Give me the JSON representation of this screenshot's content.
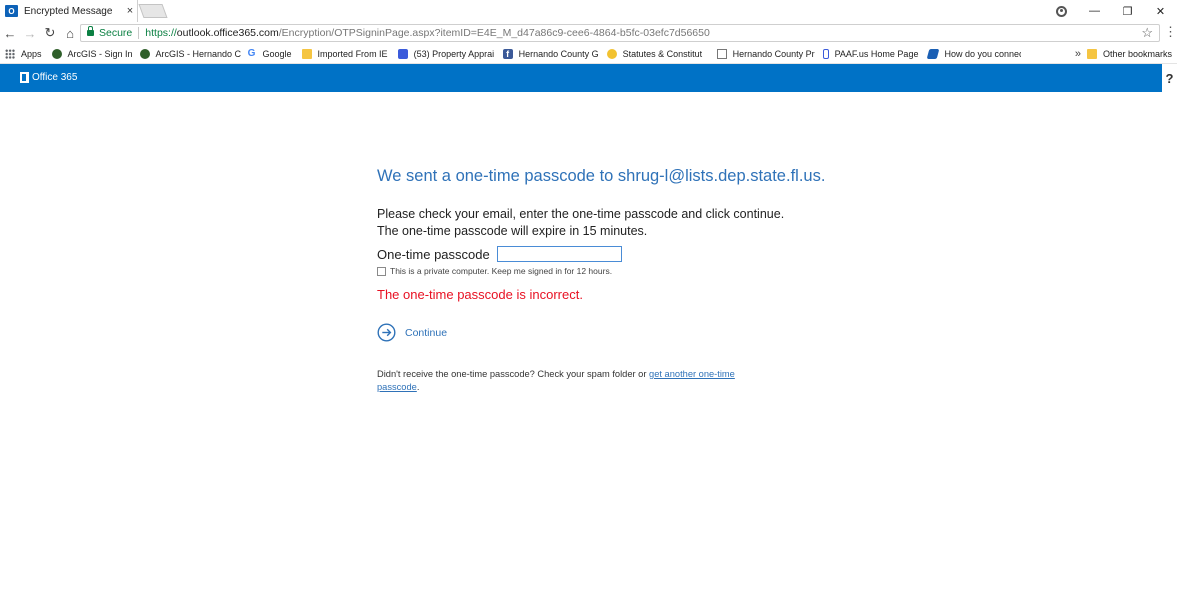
{
  "browser": {
    "tab_title": "Encrypted Message",
    "tab_favicon_letter": "O",
    "tab_close": "×",
    "secure_label": "Secure",
    "url_scheme": "https://",
    "url_host": "outlook.office365.com",
    "url_path": "/Encryption/OTPSigninPage.aspx?itemID=E4E_M_d47a86c9-cee6-4864-b5fc-03efc7d56650",
    "controls": {
      "minimize": "—",
      "restore": "❐",
      "close": "✕"
    },
    "nav": {
      "back": "←",
      "forward": "→",
      "reload": "↻",
      "home": "⌂"
    },
    "star": "☆",
    "menu": "⋮"
  },
  "bookmarks": {
    "items": [
      {
        "label": "Apps",
        "icon": "apps-icon"
      },
      {
        "label": "ArcGIS - Sign In",
        "icon": "globe-icon"
      },
      {
        "label": "ArcGIS - Hernando C",
        "icon": "globe-icon"
      },
      {
        "label": "Google",
        "icon": "google-icon"
      },
      {
        "label": "Imported From IE",
        "icon": "folder-icon"
      },
      {
        "label": "(53) Property Apprai",
        "icon": "site-icon"
      },
      {
        "label": "Hernando County G",
        "icon": "facebook-icon"
      },
      {
        "label": "Statutes & Constitut",
        "icon": "star-icon"
      },
      {
        "label": "Hernando County Pr",
        "icon": "page-icon"
      },
      {
        "label": "PAAF.us Home Page",
        "icon": "bar-icon"
      },
      {
        "label": "How do you connec",
        "icon": "arrow-icon"
      }
    ],
    "overflow": "»",
    "other": "Other bookmarks"
  },
  "header": {
    "brand": "Office 365",
    "help": "?"
  },
  "main": {
    "heading": "We sent a one-time passcode to shrug-l@lists.dep.state.fl.us.",
    "instruction_line1": "Please check your email, enter the one-time passcode and click continue.",
    "instruction_line2": "The one-time passcode will expire in 15 minutes.",
    "passcode_label": "One-time passcode",
    "passcode_value": "",
    "remember_label": "This is a private computer. Keep me signed in for 12 hours.",
    "error": "The one-time passcode is incorrect.",
    "continue_label": "Continue",
    "resend_prefix": "Didn't receive the one-time passcode? Check your spam folder or ",
    "resend_link": "get another one-time passcode",
    "resend_suffix": "."
  },
  "colors": {
    "brand_blue": "#0072c6",
    "heading_blue": "#2f72b8",
    "error_red": "#e81123",
    "secure_green": "#0b8043"
  }
}
